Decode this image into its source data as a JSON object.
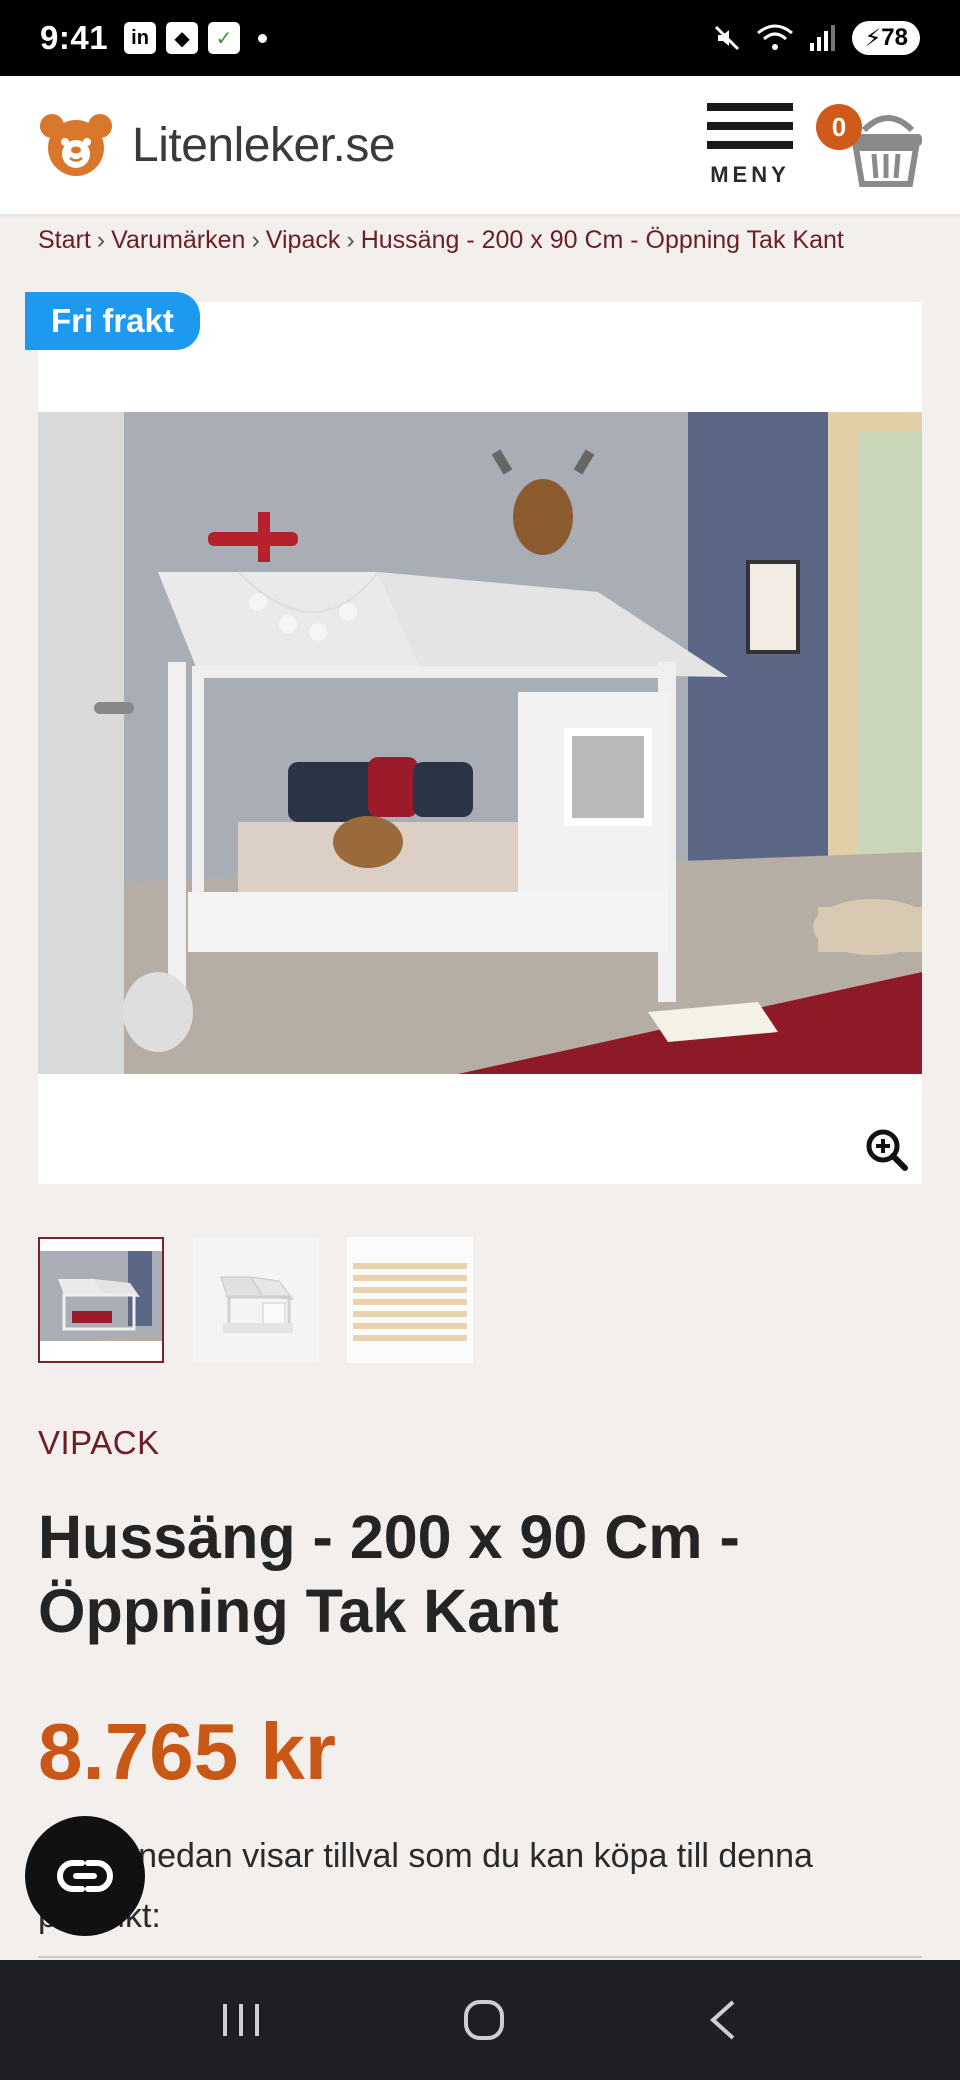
{
  "status_bar": {
    "time": "9:41",
    "battery": "78",
    "app_icons": [
      "linkedin-icon",
      "dropbox-icon",
      "app-icon"
    ]
  },
  "header": {
    "logo_text": "Litenleker.se",
    "menu_label": "MENY",
    "cart_count": "0"
  },
  "breadcrumb": {
    "items": [
      "Start",
      "Varumärken",
      "Vipack",
      "Hussäng - 200 x 90 Cm - Öppning Tak Kant"
    ],
    "separator": "›"
  },
  "product": {
    "badge": "Fri frakt",
    "brand": "VIPACK",
    "title": "Hussäng - 200 x 90 Cm - Öppning Tak Kant",
    "price": "8.765 kr",
    "description": "Listan nedan visar tillval som du kan köpa till denna produkt:",
    "thumbnails": [
      "Hussäng rum",
      "Hussäng vit",
      "Ribbotten"
    ]
  },
  "colors": {
    "accent": "#c95716",
    "brand_text": "#6b1f24",
    "badge_blue": "#1d9af0"
  }
}
